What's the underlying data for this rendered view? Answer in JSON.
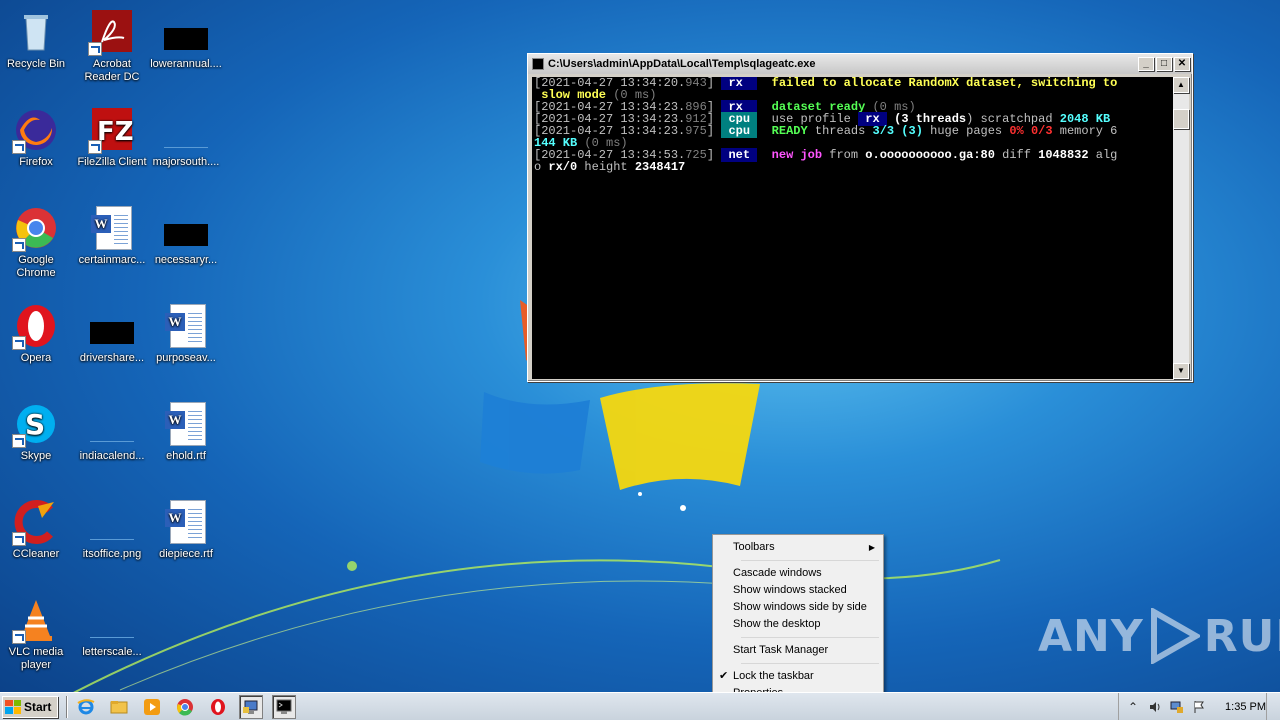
{
  "desktop": {
    "icons": [
      {
        "label": "Recycle Bin",
        "icon": "recycle-bin-icon"
      },
      {
        "label": "Acrobat Reader DC",
        "icon": "acrobat-reader-icon"
      },
      {
        "label": "lowerannual....",
        "icon": "file-icon"
      },
      {
        "label": "Firefox",
        "icon": "firefox-icon"
      },
      {
        "label": "FileZilla Client",
        "icon": "filezilla-icon"
      },
      {
        "label": "majorsouth....",
        "icon": "file-icon"
      },
      {
        "label": "Google Chrome",
        "icon": "chrome-icon"
      },
      {
        "label": "certainmarc...",
        "icon": "word-document-icon"
      },
      {
        "label": "necessaryr...",
        "icon": "file-icon"
      },
      {
        "label": "Opera",
        "icon": "opera-icon"
      },
      {
        "label": "drivershare...",
        "icon": "file-icon"
      },
      {
        "label": "purposeav...",
        "icon": "word-document-icon"
      },
      {
        "label": "Skype",
        "icon": "skype-icon"
      },
      {
        "label": "indiacalend...",
        "icon": "file-icon"
      },
      {
        "label": "ehold.rtf",
        "icon": "word-document-icon"
      },
      {
        "label": "CCleaner",
        "icon": "ccleaner-icon"
      },
      {
        "label": "itsoffice.png",
        "icon": "file-icon"
      },
      {
        "label": "diepiece.rtf",
        "icon": "word-document-icon"
      },
      {
        "label": "VLC media player",
        "icon": "vlc-icon"
      },
      {
        "label": "letterscale...",
        "icon": "file-icon"
      }
    ]
  },
  "console": {
    "title": "C:\\Users\\admin\\AppData\\Local\\Temp\\sqlageatc.exe",
    "lines": [
      [
        {
          "t": "[2021-04-27 13:34:20.",
          "c": "ts"
        },
        {
          "t": "943",
          "c": "gray"
        },
        {
          "t": "] ",
          "c": "ts"
        },
        {
          "t": " rx  ",
          "c": "tag-rx"
        },
        {
          "t": "  failed to allocate RandomX dataset, switching to",
          "c": "yellow"
        }
      ],
      [
        {
          "t": " slow mode ",
          "c": "yellow"
        },
        {
          "t": "(0 ms)",
          "c": "gray"
        }
      ],
      [
        {
          "t": "[2021-04-27 13:34:23.",
          "c": "ts"
        },
        {
          "t": "896",
          "c": "gray"
        },
        {
          "t": "] ",
          "c": "ts"
        },
        {
          "t": " rx  ",
          "c": "tag-rx"
        },
        {
          "t": "  dataset ready ",
          "c": "green"
        },
        {
          "t": "(0 ms)",
          "c": "gray"
        }
      ],
      [
        {
          "t": "[2021-04-27 13:34:23.",
          "c": "ts"
        },
        {
          "t": "912",
          "c": "gray"
        },
        {
          "t": "] ",
          "c": "ts"
        },
        {
          "t": " cpu ",
          "c": "tag-cpu"
        },
        {
          "t": "  use profile ",
          "c": "plain"
        },
        {
          "t": " rx ",
          "c": "tag-rx"
        },
        {
          "t": " (",
          "c": "white"
        },
        {
          "t": "3 threads",
          "c": "white"
        },
        {
          "t": ") scratchpad ",
          "c": "plain"
        },
        {
          "t": "2048 KB",
          "c": "cyan"
        }
      ],
      [
        {
          "t": "[2021-04-27 13:34:23.",
          "c": "ts"
        },
        {
          "t": "975",
          "c": "gray"
        },
        {
          "t": "] ",
          "c": "ts"
        },
        {
          "t": " cpu ",
          "c": "tag-cpu"
        },
        {
          "t": "  READY",
          "c": "green"
        },
        {
          "t": " threads ",
          "c": "plain"
        },
        {
          "t": "3/3 (3)",
          "c": "cyan"
        },
        {
          "t": " huge pages ",
          "c": "plain"
        },
        {
          "t": "0% 0/3",
          "c": "red"
        },
        {
          "t": " memory 6",
          "c": "plain"
        }
      ],
      [
        {
          "t": "144 KB",
          "c": "cyan"
        },
        {
          "t": " (0 ms)",
          "c": "gray"
        }
      ],
      [
        {
          "t": "[2021-04-27 13:34:53.",
          "c": "ts"
        },
        {
          "t": "725",
          "c": "gray"
        },
        {
          "t": "] ",
          "c": "ts"
        },
        {
          "t": " net ",
          "c": "tag-net"
        },
        {
          "t": "  new job",
          "c": "magenta"
        },
        {
          "t": " from ",
          "c": "plain"
        },
        {
          "t": "o.oooooooooo.ga:80",
          "c": "white"
        },
        {
          "t": " diff ",
          "c": "plain"
        },
        {
          "t": "1048832",
          "c": "white"
        },
        {
          "t": " alg",
          "c": "plain"
        }
      ],
      [
        {
          "t": "o ",
          "c": "plain"
        },
        {
          "t": "rx/0",
          "c": "white"
        },
        {
          "t": " height ",
          "c": "plain"
        },
        {
          "t": "2348417",
          "c": "white"
        }
      ]
    ]
  },
  "context_menu": {
    "toolbars": "Toolbars",
    "cascade": "Cascade windows",
    "stacked": "Show windows stacked",
    "side_by_side": "Show windows side by side",
    "show_desktop": "Show the desktop",
    "task_manager": "Start Task Manager",
    "lock_taskbar": "Lock the taskbar",
    "properties": "Properties"
  },
  "taskbar": {
    "start_label": "Start",
    "clock": "1:35 PM",
    "quick_launch": [
      "internet-explorer-icon",
      "explorer-folder-icon",
      "media-player-icon",
      "chrome-icon",
      "opera-icon",
      "network-app-icon",
      "console-app-icon"
    ]
  },
  "watermark": {
    "left": "ANY",
    "right": "RUN"
  }
}
